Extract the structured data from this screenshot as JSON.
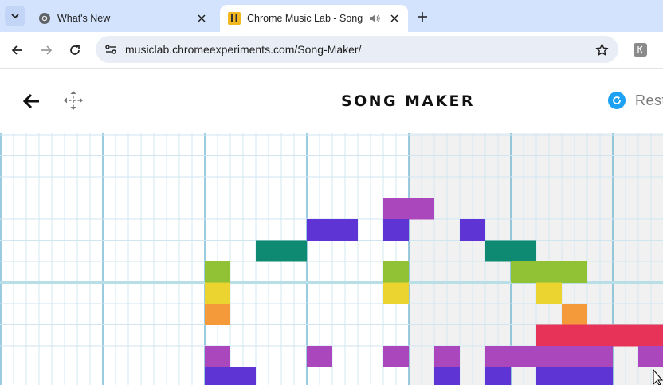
{
  "browser": {
    "tabs": [
      {
        "title": "What's New",
        "favicon": "chrome-icon",
        "active": false
      },
      {
        "title": "Chrome Music Lab - Song Maker",
        "favicon": "music-lab-icon",
        "active": true,
        "audio": true
      }
    ],
    "url": "musiclab.chromeexperiments.com/Song-Maker/"
  },
  "app": {
    "title": "SONG MAKER",
    "restart_label": "Restart"
  },
  "colors": {
    "tabstrip": "#d3e3fd",
    "gridline": "#cfe6f1",
    "measure_line": "#58a9cb",
    "shaded_region": "#f1f1f1",
    "note_palette": {
      "purple": "#ab47bc",
      "indigo": "#5e35d4",
      "teal": "#0e8a72",
      "lime": "#91c236",
      "yellow": "#ebd330",
      "orange": "#f49a3b",
      "red": "#e63357"
    }
  },
  "grid": {
    "visible_columns": 26,
    "visible_rows": 12,
    "playhead_row": 7,
    "shaded_from_column": 16,
    "measure_every": 4,
    "notes": [
      {
        "col": 15,
        "row": 3,
        "len": 2,
        "color": "purple"
      },
      {
        "col": 12,
        "row": 4,
        "len": 2,
        "color": "indigo"
      },
      {
        "col": 15,
        "row": 4,
        "len": 1,
        "color": "indigo"
      },
      {
        "col": 18,
        "row": 4,
        "len": 1,
        "color": "indigo"
      },
      {
        "col": 10,
        "row": 5,
        "len": 2,
        "color": "teal"
      },
      {
        "col": 19,
        "row": 5,
        "len": 2,
        "color": "teal"
      },
      {
        "col": 8,
        "row": 6,
        "len": 1,
        "color": "lime"
      },
      {
        "col": 15,
        "row": 6,
        "len": 1,
        "color": "lime"
      },
      {
        "col": 20,
        "row": 6,
        "len": 3,
        "color": "lime"
      },
      {
        "col": 8,
        "row": 7,
        "len": 1,
        "color": "yellow"
      },
      {
        "col": 15,
        "row": 7,
        "len": 1,
        "color": "yellow"
      },
      {
        "col": 21,
        "row": 7,
        "len": 1,
        "color": "yellow"
      },
      {
        "col": 8,
        "row": 8,
        "len": 1,
        "color": "orange"
      },
      {
        "col": 22,
        "row": 8,
        "len": 1,
        "color": "orange"
      },
      {
        "col": 21,
        "row": 9,
        "len": 5,
        "color": "red"
      },
      {
        "col": 8,
        "row": 10,
        "len": 1,
        "color": "purple"
      },
      {
        "col": 12,
        "row": 10,
        "len": 1,
        "color": "purple"
      },
      {
        "col": 15,
        "row": 10,
        "len": 1,
        "color": "purple"
      },
      {
        "col": 17,
        "row": 10,
        "len": 1,
        "color": "purple"
      },
      {
        "col": 19,
        "row": 10,
        "len": 5,
        "color": "purple"
      },
      {
        "col": 25,
        "row": 10,
        "len": 1,
        "color": "purple"
      },
      {
        "col": 8,
        "row": 11,
        "len": 2,
        "color": "indigo"
      },
      {
        "col": 17,
        "row": 11,
        "len": 1,
        "color": "indigo"
      },
      {
        "col": 19,
        "row": 11,
        "len": 1,
        "color": "indigo"
      },
      {
        "col": 21,
        "row": 11,
        "len": 3,
        "color": "indigo"
      }
    ]
  }
}
